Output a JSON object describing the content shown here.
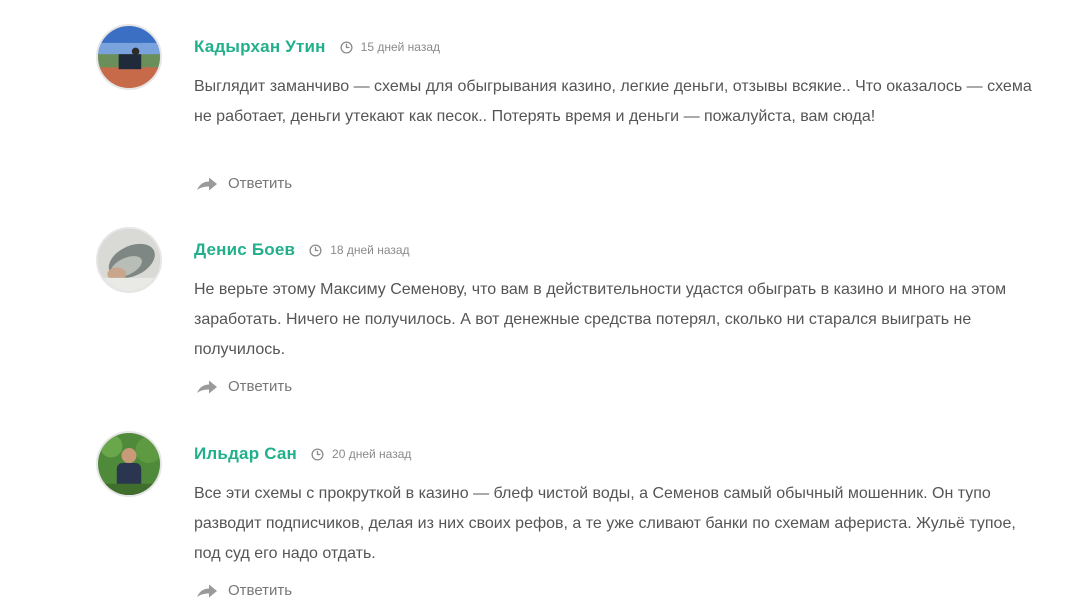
{
  "comments": [
    {
      "author": "Кадырхан Утин",
      "date": "15 дней назад",
      "text": "Выглядит заманчиво — схемы для обыгрывания казино, легкие деньги, отзывы всякие.. Что оказалось — схема не работает, деньги утекают как песок.. Потерять время и деньги — пожалуйста, вам сюда!",
      "reply_label": "Ответить",
      "avatar_icon": "user-avatar-icon"
    },
    {
      "author": "Денис Боев",
      "date": "18 дней назад",
      "text": "Не верьте этому Максиму Семенову, что вам в действительности удастся обыграть в казино и много на этом заработать. Ничего не получилось. А вот денежные средства потерял, сколько ни старался выиграть не получилось.",
      "reply_label": "Ответить",
      "avatar_icon": "user-avatar-icon"
    },
    {
      "author": "Ильдар Сан",
      "date": "20 дней назад",
      "text": "Все эти схемы с прокруткой в казино — блеф чистой воды, а Семенов самый обычный мошенник. Он тупо разводит подписчиков, делая из них своих рефов, а те уже сливают банки по схемам афериста. Жульё тупое, под суд его надо отдать.",
      "reply_label": "Ответить",
      "avatar_icon": "user-avatar-icon"
    }
  ],
  "icons": {
    "clock": "clock-icon",
    "reply": "reply-arrow-icon"
  },
  "colors": {
    "author": "#22b08c",
    "text": "#555555",
    "date": "#8a8a8a",
    "reply": "#777777",
    "reply_icon": "#9a9a9a"
  }
}
